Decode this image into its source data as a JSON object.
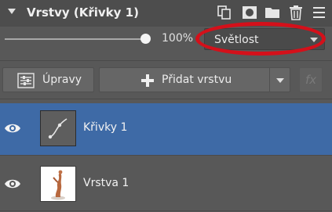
{
  "panel": {
    "title": "Vrstvy (Křivky 1)",
    "header_icons": [
      "duplicate-layer-icon",
      "mask-icon",
      "folder-icon",
      "trash-icon",
      "menu-icon"
    ]
  },
  "opacity": {
    "value": 1.0,
    "label": "100%"
  },
  "blend_mode": {
    "selected": "Světlost",
    "highlight_color": "#d4101a"
  },
  "actions": {
    "edit_label": "Úpravy",
    "add_layer_label": "Přidat vrstvu",
    "fx_label": "fx"
  },
  "layers": [
    {
      "name": "Křivky 1",
      "selected": true,
      "visible": true,
      "thumbnail": "curves-adjustment-thumbnail"
    },
    {
      "name": "Vrstva 1",
      "selected": false,
      "visible": true,
      "thumbnail": "statuette-photo-thumbnail"
    }
  ],
  "colors": {
    "selected_row": "#3e6aa6",
    "panel_bg": "#585858"
  }
}
